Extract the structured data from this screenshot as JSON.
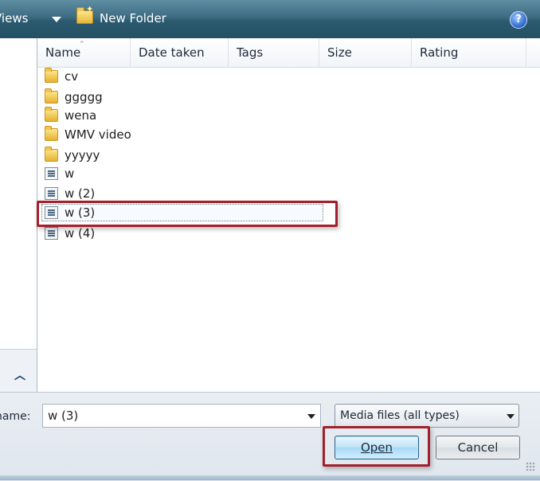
{
  "toolbar": {
    "views_label": "Views",
    "new_folder_label": "New Folder",
    "help_icon": "help-icon",
    "folder_icon": "new-folder-icon"
  },
  "columns": {
    "name": "Name",
    "date_taken": "Date taken",
    "tags": "Tags",
    "size": "Size",
    "rating": "Rating"
  },
  "items": [
    {
      "label": "cv",
      "kind": "folder"
    },
    {
      "label": "ggggg",
      "kind": "folder"
    },
    {
      "label": "wena",
      "kind": "folder"
    },
    {
      "label": "WMV video",
      "kind": "folder"
    },
    {
      "label": "yyyyy",
      "kind": "folder"
    },
    {
      "label": "w",
      "kind": "media"
    },
    {
      "label": "w (2)",
      "kind": "media"
    },
    {
      "label": "w (3)",
      "kind": "media",
      "selected": true
    },
    {
      "label": "w (4)",
      "kind": "media"
    }
  ],
  "filename": {
    "label": "name:",
    "value": "w (3)"
  },
  "file_type": {
    "selected": "Media files (all types)"
  },
  "buttons": {
    "open": "Open",
    "cancel": "Cancel"
  },
  "highlight_color": "#a31f2a"
}
